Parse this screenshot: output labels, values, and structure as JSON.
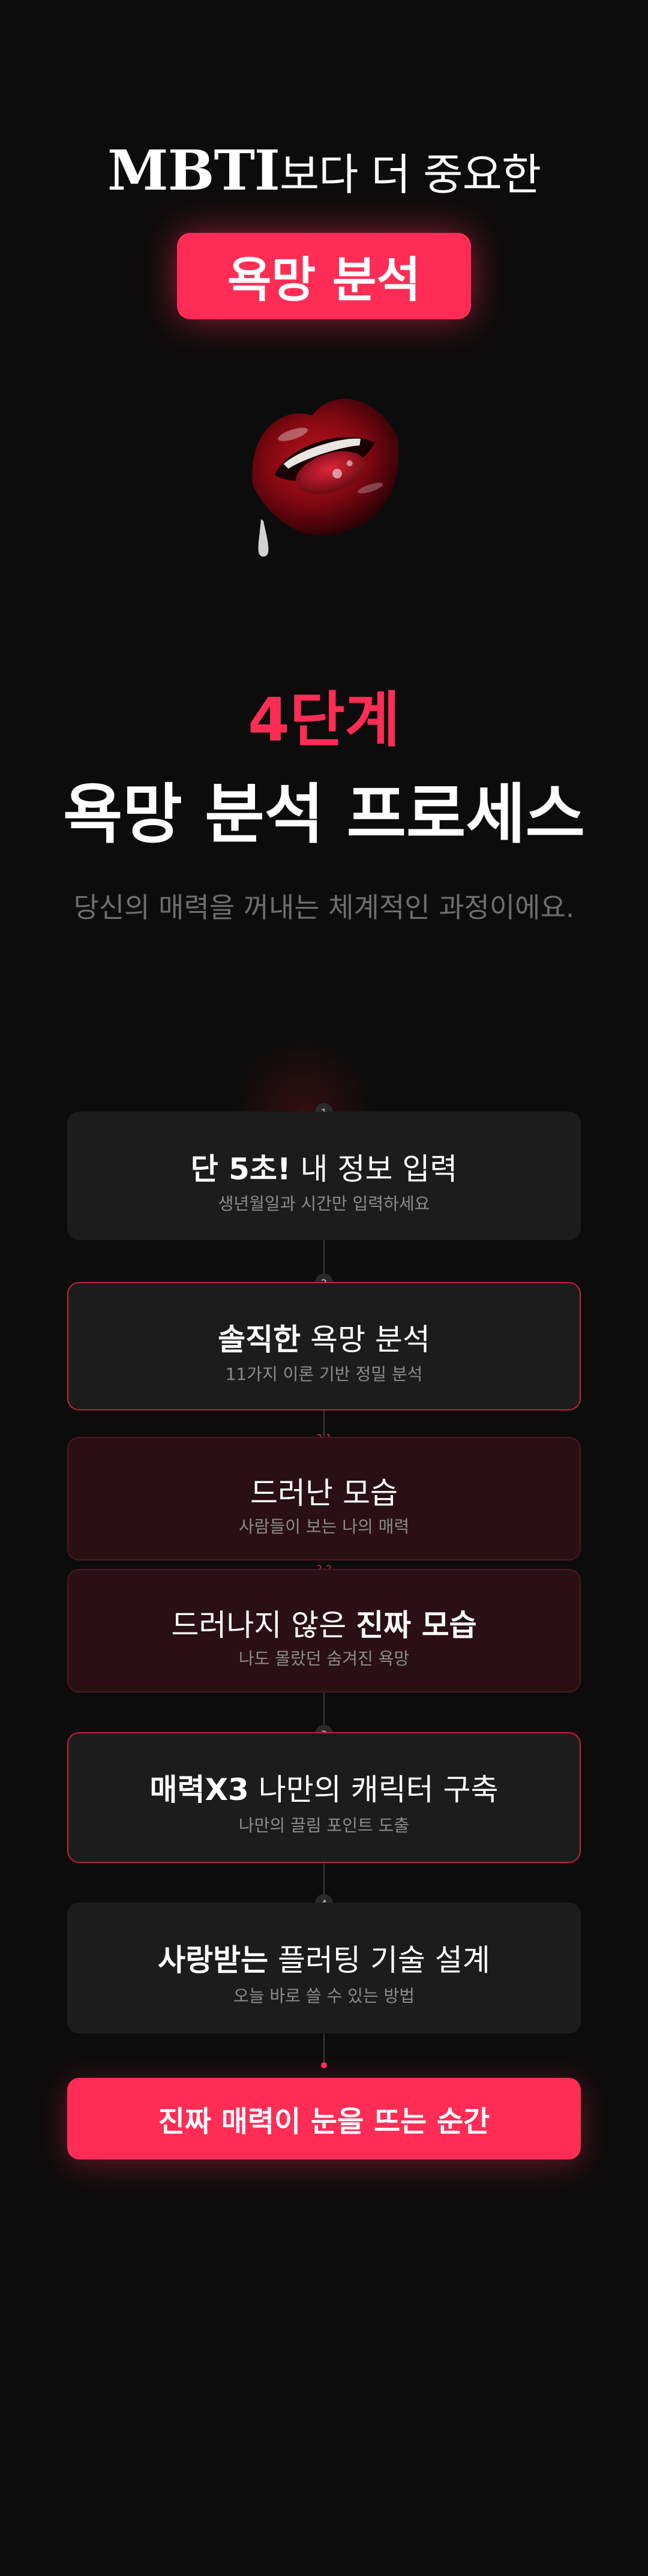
{
  "hero": {
    "brand": "MBTI",
    "line1_rest": "보다 더 중요한",
    "pill_title": "욕망 분석"
  },
  "process": {
    "step_count": "4단계",
    "title": "욕망 분석 프로세스",
    "subtitle": "당신의 매력을 꺼내는 체계적인 과정이에요."
  },
  "steps": [
    {
      "badge": "1",
      "title_bold": "단 5초!",
      "title_rest": " 내 정보 입력",
      "desc": "생년월일과 시간만 입력하세요"
    },
    {
      "badge": "2",
      "title_bold": "솔직한",
      "title_rest": " 욕망 분석",
      "desc": "11가지 이론 기반 정밀 분석"
    },
    {
      "badge": "2-1",
      "title_bold": "",
      "title_rest": "드러난 모습",
      "desc": "사람들이 보는 나의 매력"
    },
    {
      "badge": "2-2",
      "title_pre": "드러나지 않은 ",
      "title_bold": "진짜 모습",
      "desc": "나도 몰랐던 숨겨진 욕망"
    },
    {
      "badge": "3",
      "title_bold": "매력X3",
      "title_rest": " 나만의 캐릭터 구축",
      "desc": "나만의 끌림 포인트 도출"
    },
    {
      "badge": "4",
      "title_bold": "사랑받는",
      "title_rest": " 플러팅 기술 설계",
      "desc": "오늘 바로 쓸 수 있는 방법"
    }
  ],
  "cta": {
    "label": "진짜 매력이 눈을 뜨는 순간"
  },
  "colors": {
    "accent": "#ff2d55",
    "background": "#0d0c0c",
    "card": "#1c1c1c",
    "card_dark_red": "#2a0f14"
  }
}
